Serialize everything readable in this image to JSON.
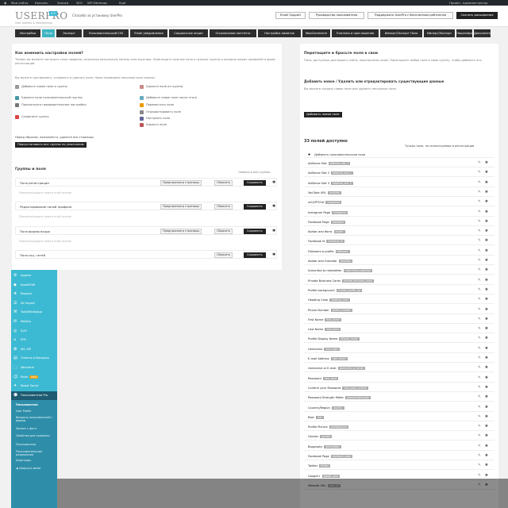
{
  "adminbar": {
    "items": [
      "Мои сайты",
      "Консоль",
      "Записи",
      "SEO",
      "WP-Sitemaps",
      "Ещё"
    ],
    "right": "Привет, Администратор"
  },
  "header": {
    "logo": "USERPRO",
    "version": "4.9",
    "subtitle": "User profiles & Membership",
    "thanks": "Спасибо за установку UserPro",
    "buttons": [
      "Email Support",
      "Руководство пользователя",
      "Поддержать UserPro с бесплатным рейтингом",
      "Скачать расширения"
    ]
  },
  "tabs": [
    "Настройки",
    "Поля",
    "Экспорт",
    "Пользовательский CSS",
    "Email уведомления",
    "Социальные опции",
    "Ограничение контента",
    "Настройка лимитов",
    "WooCommerce",
    "Платежи и приглашения",
    "Импорт/Экспорт Поля",
    "Импорт/Экспорт",
    "Лицензирование",
    "Дополнительно"
  ],
  "left": {
    "howto_title": "Как изменить настройки полей?",
    "howto_text": "Теперь вы можете настроить поля профиля, используя визуальную панель конструктора. Перетащите нужные поля в нужные группы и разделы ваших профилей и форм регистрации.",
    "howto_text2": "Вы можете сортировать, создавать и удалять поля. Ниже приведено описание всех иконок:",
    "icons": [
      {
        "label": "Добавьте новое поле в группу",
        "color": "#999"
      },
      {
        "label": "Удалите поле из группы",
        "color": "#c88"
      },
      {
        "label": "Добавьте новое поле после этого",
        "color": "#6ab"
      },
      {
        "label": "Удалите поле пользовательской группы",
        "color": "#49a"
      },
      {
        "label": "Просмотрите предварительные настройки",
        "color": "#777"
      },
      {
        "label": "Сохраните группу",
        "color": "#d44"
      },
      {
        "label": "Переместить поле",
        "color": "#e90"
      },
      {
        "label": "Отредактировать поле",
        "color": "#888"
      },
      {
        "label": "Настроить поле",
        "color": "#669"
      },
      {
        "label": "Удалить поле",
        "color": "#b55"
      }
    ],
    "reset_note": "Перед сбросом, пожалуйста, удалите все страницы",
    "reset_button": "Переустановить все группы по умолчанию",
    "groups_title": "Группы и поля",
    "collapse_link": "Свернуть все группы",
    "groups": [
      {
        "name": "Поля регистрации",
        "meta": "Показать/скрыть поля в этой группе"
      },
      {
        "name": "Редактирование полей профиля",
        "meta": "Показать/скрыть поля в этой группе"
      },
      {
        "name": "Поля формы входа",
        "meta": "Показать/скрыть поля в этой группе"
      },
      {
        "name": "Поля соц. сетей",
        "meta": ""
      }
    ],
    "preview_label": "Предпросмотр страницы",
    "reset_label": "Сбросить",
    "save_label": "Сохранить"
  },
  "right": {
    "dnd_title": "Перетащите и бросьте поля в свои",
    "dnd_text": "Поля, доступные для вашего сайта, перечислены ниже. Перетащите любое поле в свою группу, чтобы добавить его.",
    "addnew_title": "Добавить новое / Удалить или отредактировать существующие данные",
    "addnew_text": "Вы можете создать новое поле или удалить ненужные поля.",
    "addnew_button": "Добавить новое поле"
  },
  "fields_panel": {
    "count_title": "33 полей доступно",
    "filter_label": "Только поля, не используемые в регистрации",
    "add_label": "Добавить пользовательские поля",
    "fields": [
      {
        "name": "AdSense Slot",
        "key": "adsense_slot_1"
      },
      {
        "name": "AdSense Slot 2",
        "key": "adsense_slot_2"
      },
      {
        "name": "AdSense Slot 3",
        "key": "adsense_slot_3"
      },
      {
        "name": "YouTube URL",
        "key": "youtube"
      },
      {
        "name": "reCAPTCHA",
        "key": "recaptcha"
      },
      {
        "name": "Instagram Page",
        "key": "instagram"
      },
      {
        "name": "Facebook Page",
        "key": "facebook"
      },
      {
        "name": "Avatar или Фото",
        "key": "avatar"
      },
      {
        "name": "Facebook Id",
        "key": "facebook_id"
      },
      {
        "name": "Followers в profile",
        "key": "followers"
      },
      {
        "name": "Avatar или Gravatar",
        "key": "gravatar"
      },
      {
        "name": "Subscribe to newsletter",
        "key": "mailchimp_subscribe"
      },
      {
        "name": "Private Business Cards",
        "key": "private_business_cards"
      },
      {
        "name": "Profile background",
        "key": "custom_profile_bg"
      },
      {
        "name": "Heading Color",
        "key": "heading_color"
      },
      {
        "name": "Phone Number",
        "key": "phone_number"
      },
      {
        "name": "First Name",
        "key": "first_name"
      },
      {
        "name": "Last Name",
        "key": "last_name"
      },
      {
        "name": "Profile Display Name",
        "key": "display_name"
      },
      {
        "name": "Username",
        "key": "user_login"
      },
      {
        "name": "E-mail Address",
        "key": "user_email"
      },
      {
        "name": "Username or E-mail",
        "key": "username_or_email"
      },
      {
        "name": "Password",
        "key": "user_pass"
      },
      {
        "name": "Confirm your Password",
        "key": "user_pass_confirm"
      },
      {
        "name": "Password Strength Meter",
        "key": "passwordstrength"
      },
      {
        "name": "Country/Region",
        "key": "country"
      },
      {
        "name": "Role",
        "key": "role"
      },
      {
        "name": "Profile Picture",
        "key": "profilepicture"
      },
      {
        "name": "Gender",
        "key": "gender"
      },
      {
        "name": "Biography",
        "key": "description"
      },
      {
        "name": "Facebook Page",
        "key": "facebook_page"
      },
      {
        "name": "Twitter",
        "key": "twitter"
      },
      {
        "name": "Google+",
        "key": "google_plus"
      },
      {
        "name": "Website URL",
        "key": "user_url"
      }
    ]
  },
  "sidebar": {
    "items": [
      {
        "icon": "⚙",
        "label": "Appear"
      },
      {
        "icon": "◆",
        "label": "bookNOW"
      },
      {
        "icon": "★",
        "label": "Reports"
      },
      {
        "icon": "☰",
        "label": "All Import"
      },
      {
        "icon": "⚒",
        "label": "Tool/Whatsapp"
      },
      {
        "icon": "✉",
        "label": "Mailers"
      },
      {
        "icon": "◎",
        "label": "SVG"
      },
      {
        "icon": "⌂",
        "label": "EPS"
      },
      {
        "icon": "✿",
        "label": "WC API"
      },
      {
        "icon": "▤",
        "label": "Ответы и Вопросы"
      },
      {
        "icon": "⬚",
        "label": "Welcome"
      },
      {
        "icon": "☺",
        "label": "Rank",
        "badge": "NEW"
      },
      {
        "icon": "✦",
        "label": "Boost Social"
      },
      {
        "icon": "☻",
        "label": "Пользователи Pro"
      }
    ],
    "submenu": [
      "Пользователи",
      "User Profile",
      "Вопросы пользователей / формы",
      "Записи с фото",
      "Свойства для подписки",
      "Пользователи",
      "Пользовательские разрешения",
      "Шорткоды"
    ],
    "collapse": "Свернуть меню"
  }
}
